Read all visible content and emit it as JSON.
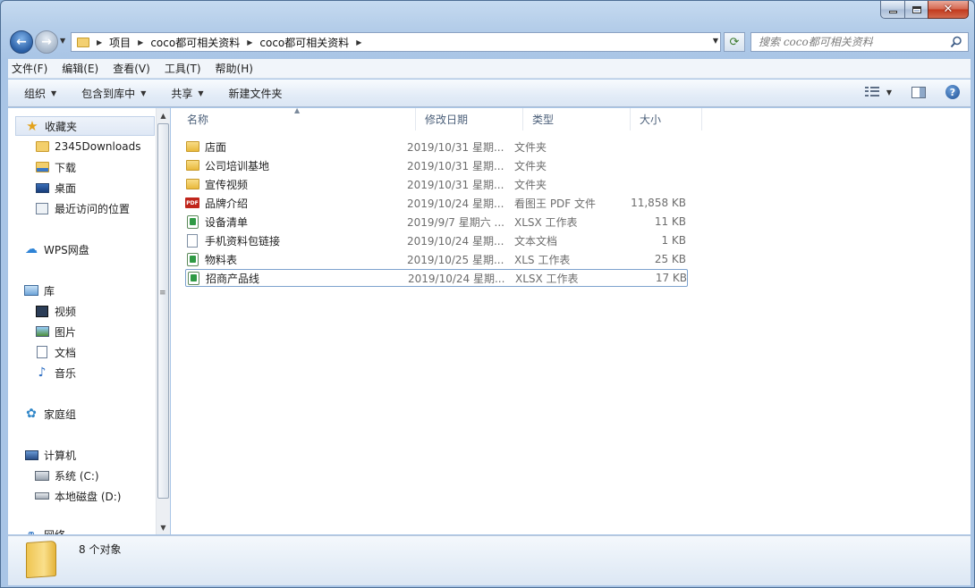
{
  "address": {
    "crumbs": [
      "项目",
      "coco都可相关资料",
      "coco都可相关资料"
    ],
    "search_placeholder": "搜索 coco都可相关资料"
  },
  "menu": [
    "文件(F)",
    "编辑(E)",
    "查看(V)",
    "工具(T)",
    "帮助(H)"
  ],
  "commands": {
    "organize": "组织",
    "include_library": "包含到库中",
    "share": "共享",
    "new_folder": "新建文件夹"
  },
  "nav": {
    "favorites": "收藏夹",
    "fav_items": [
      "2345Downloads",
      "下载",
      "桌面",
      "最近访问的位置"
    ],
    "wps": "WPS网盘",
    "libraries": "库",
    "lib_items": [
      "视频",
      "图片",
      "文档",
      "音乐"
    ],
    "homegroup": "家庭组",
    "computer": "计算机",
    "drives": [
      "系统 (C:)",
      "本地磁盘 (D:)"
    ],
    "network": "网络"
  },
  "columns": [
    "名称",
    "修改日期",
    "类型",
    "大小"
  ],
  "files": [
    {
      "name": "店面",
      "date": "2019/10/31 星期...",
      "type": "文件夹",
      "size": "",
      "icon": "folder-icon"
    },
    {
      "name": "公司培训基地",
      "date": "2019/10/31 星期...",
      "type": "文件夹",
      "size": "",
      "icon": "folder-icon"
    },
    {
      "name": "宣传视频",
      "date": "2019/10/31 星期...",
      "type": "文件夹",
      "size": "",
      "icon": "folder-icon"
    },
    {
      "name": "品牌介绍",
      "date": "2019/10/24 星期...",
      "type": "看图王 PDF 文件",
      "size": "11,858 KB",
      "icon": "pdf-icon"
    },
    {
      "name": "设备清单",
      "date": "2019/9/7 星期六 ...",
      "type": "XLSX 工作表",
      "size": "11 KB",
      "icon": "xlsx-icon"
    },
    {
      "name": "手机资料包链接",
      "date": "2019/10/24 星期...",
      "type": "文本文档",
      "size": "1 KB",
      "icon": "txt-icon"
    },
    {
      "name": "物料表",
      "date": "2019/10/25 星期...",
      "type": "XLS 工作表",
      "size": "25 KB",
      "icon": "xls-icon"
    },
    {
      "name": "招商产品线",
      "date": "2019/10/24 星期...",
      "type": "XLSX 工作表",
      "size": "17 KB",
      "icon": "xlsx-icon"
    }
  ],
  "status": {
    "count_text": "8 个对象"
  }
}
